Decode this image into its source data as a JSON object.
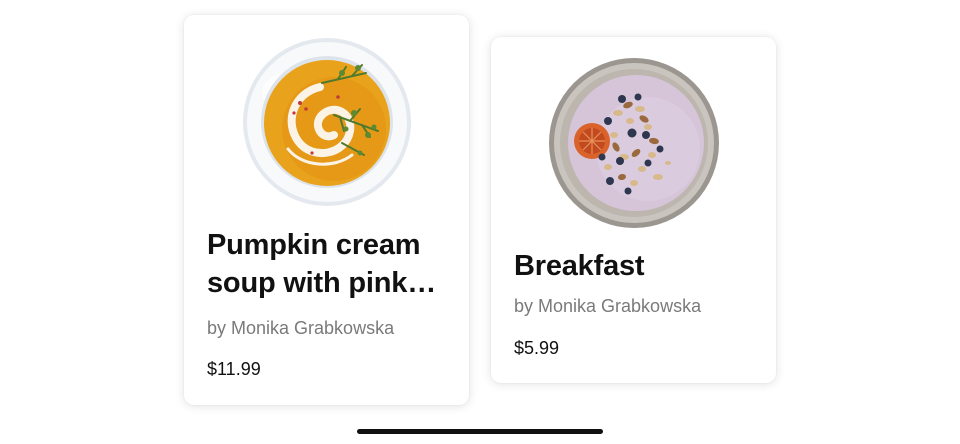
{
  "products": [
    {
      "title": "Pumpkin cream soup with pink pepper",
      "author": "by Monika Grabkowska",
      "price": "$11.99",
      "image_icon": "pumpkin-soup-bowl"
    },
    {
      "title": "Breakfast",
      "author": "by Monika Grabkowska",
      "price": "$5.99",
      "image_icon": "smoothie-bowl"
    }
  ],
  "colors": {
    "text_primary": "#111111",
    "text_secondary": "#7a7a7a",
    "card_background": "#ffffff",
    "soup": "#e9a21b",
    "smoothie": "#d6c5d9"
  }
}
